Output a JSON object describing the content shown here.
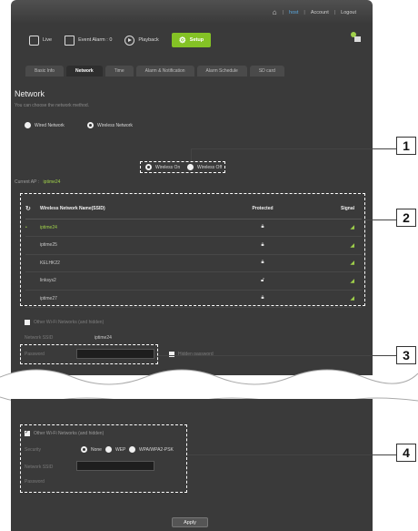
{
  "topbar": {
    "home_icon": "home-icon",
    "host": "host",
    "account": "Account",
    "logout": "Logout"
  },
  "mainnav": {
    "live": "Live",
    "event_alarm": "Event Alarm : 0",
    "playback": "Playback",
    "setup": "Setup"
  },
  "tabs": [
    "Basic Info",
    "Network",
    "Time",
    "Alarm & Notification",
    "Alarm Schedule",
    "SD card"
  ],
  "network": {
    "title": "Network",
    "description": "You can choose the network method.",
    "wired": "Wired Network",
    "wireless": "Wireless Network",
    "wireless_on": "Wireless On",
    "wireless_off": "Wireless Off",
    "current_ap_label": "Current AP :",
    "current_ap_value": "iptime24"
  },
  "table": {
    "headers": [
      "Wireless Network Name(SSID)",
      "Protected",
      "Signal"
    ],
    "rows": [
      {
        "ssid": "iptime24",
        "protected": "locked",
        "selected": true
      },
      {
        "ssid": "iptime25",
        "protected": "locked",
        "selected": false
      },
      {
        "ssid": "KELHK22",
        "protected": "locked",
        "selected": false
      },
      {
        "ssid": "linksys2",
        "protected": "unlocked",
        "selected": false
      },
      {
        "ssid": "iptime27",
        "protected": "locked",
        "selected": false
      }
    ]
  },
  "other_top": {
    "label": "Other Wi-Fi Networks (and hidden)",
    "network_ssid_label": "Network SSID",
    "network_ssid_value": "iptime24",
    "password_label": "Password",
    "hide_password_label": "Hidden password"
  },
  "other_bottom": {
    "label": "Other Wi-Fi Networks (and hidden)",
    "security_label": "Security",
    "security_options": [
      "None",
      "WEP",
      "WPA/WPA2-PSK"
    ],
    "network_ssid_label": "Network SSID",
    "password_label": "Password"
  },
  "callouts": [
    "1",
    "2",
    "3",
    "4"
  ],
  "apply": "Apply",
  "colors": {
    "accent_green": "#84c225",
    "selected_text": "#9fd04a",
    "link_blue": "#5aa8e0"
  }
}
